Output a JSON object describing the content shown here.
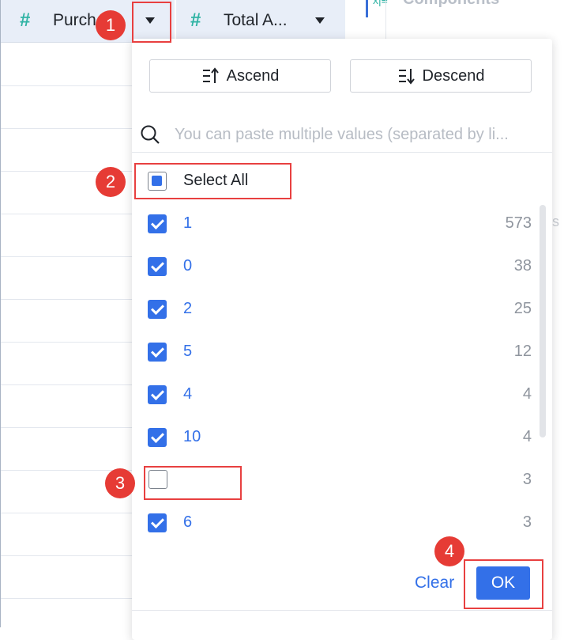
{
  "table": {
    "columns": [
      {
        "icon": "hash-icon",
        "title": "Purch"
      },
      {
        "icon": "hash-icon",
        "title": "Total A..."
      }
    ]
  },
  "right_panel": {
    "title": "Components"
  },
  "filter": {
    "sort_ascend": "Ascend",
    "sort_descend": "Descend",
    "search_placeholder": "You can paste multiple values (separated by li...",
    "select_all_label": "Select All",
    "select_all_state": "partial",
    "options": [
      {
        "label": "1",
        "count": "573",
        "checked": true
      },
      {
        "label": "0",
        "count": "38",
        "checked": true
      },
      {
        "label": "2",
        "count": "25",
        "checked": true
      },
      {
        "label": "5",
        "count": "12",
        "checked": true
      },
      {
        "label": "4",
        "count": "4",
        "checked": true
      },
      {
        "label": "10",
        "count": "4",
        "checked": true
      },
      {
        "label": "",
        "count": "3",
        "checked": false
      },
      {
        "label": "6",
        "count": "3",
        "checked": true
      }
    ],
    "clear_label": "Clear",
    "ok_label": "OK"
  },
  "annotations": {
    "steps": [
      "1",
      "2",
      "3",
      "4"
    ]
  },
  "colors": {
    "accent": "#3370e8",
    "highlight": "#e84040",
    "badge": "#e63b35",
    "header_bg": "#e8eef8",
    "hash_icon": "#2fb3a4"
  }
}
